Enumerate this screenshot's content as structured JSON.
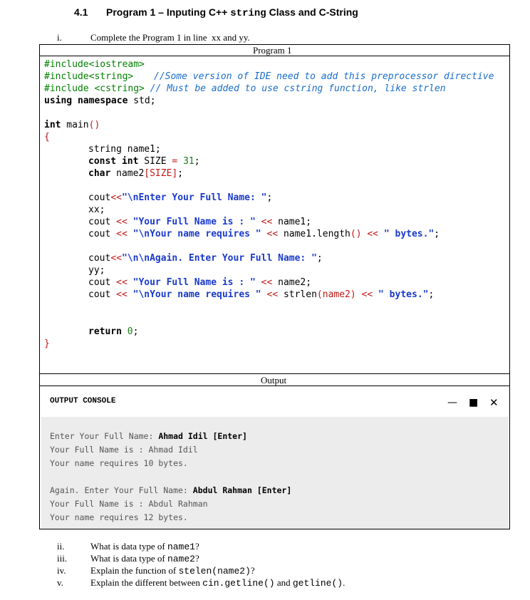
{
  "section": {
    "number": "4.1",
    "title_prefix": "Program 1 – Inputing C++ ",
    "title_mono": "string",
    "title_suffix": " Class and C-String"
  },
  "questions": [
    {
      "numeral": "i.",
      "text": "Complete the Program 1 in line  xx and yy."
    },
    {
      "numeral": "ii.",
      "text_before": "What is data type of ",
      "code": "name1",
      "text_after": "?"
    },
    {
      "numeral": "iii.",
      "text_before": "What is data type of ",
      "code": "name2",
      "text_after": "?"
    },
    {
      "numeral": "iv.",
      "text_before": "Explain the function of ",
      "code": "stelen(name2)",
      "text_after": "?"
    },
    {
      "numeral": "v.",
      "text_before": "Explain the different between ",
      "code": "cin.getline()",
      "text_mid": " and ",
      "code2": "getline()",
      "text_after": "."
    }
  ],
  "program_box": {
    "caption": "Program 1",
    "code": {
      "inc1": "#include<iostream>",
      "inc2": "#include<string>",
      "inc2_comment": "//Some version of IDE need to add this preprocessor directive",
      "inc3": "#include <cstring>",
      "inc3_comment": "// Must be added to use cstring function, like strlen",
      "using_kw": "using namespace",
      "using_rest": " std;",
      "main_kw": "int",
      "main_rest": " main",
      "main_paren": "()",
      "open_brace": "{",
      "close_brace": "}",
      "l_name1": "string name1;",
      "l_size_kw": "const int",
      "l_size_rest": " SIZE ",
      "l_size_eq": "=",
      "l_size_num": " 31",
      "l_size_end": ";",
      "l_name2_kw": "char",
      "l_name2_rest": " name2",
      "l_name2_br": "[SIZE]",
      "l_name2_end": ";",
      "cout1_a": "cout",
      "cout1_op": "<<",
      "cout1_str": "\"\\nEnter Your Full Name: \"",
      "cout1_end": ";",
      "xx": "xx;",
      "cout2_a": "cout ",
      "cout2_op": "<<",
      "cout2_str": " \"Your Full Name is : \" ",
      "cout2_op2": "<<",
      "cout2_rest": " name1;",
      "cout3_a": "cout ",
      "cout3_op": "<<",
      "cout3_str": " \"\\nYour name requires \" ",
      "cout3_op2": "<<",
      "cout3_rest": " name1.length",
      "cout3_paren": "()",
      "cout3_op3": " <<",
      "cout3_str2": " \" bytes.\"",
      "cout3_end": ";",
      "cout4_a": "cout",
      "cout4_op": "<<",
      "cout4_str": "\"\\n\\nAgain. Enter Your Full Name: \"",
      "cout4_end": ";",
      "yy": "yy;",
      "cout5_a": "cout ",
      "cout5_op": "<<",
      "cout5_str": " \"Your Full Name is : \" ",
      "cout5_op2": "<<",
      "cout5_rest": " name2;",
      "cout6_a": "cout ",
      "cout6_op": "<<",
      "cout6_str": " \"\\nYour name requires \" ",
      "cout6_op2": "<<",
      "cout6_rest": " strlen",
      "cout6_paren": "(name2)",
      "cout6_op3": " <<",
      "cout6_str2": " \" bytes.\"",
      "cout6_end": ";",
      "ret_kw": "return",
      "ret_num": " 0",
      "ret_end": ";"
    }
  },
  "output_box": {
    "caption": "Output",
    "console_title": "OUTPUT CONSOLE",
    "controls": {
      "minimize": "—",
      "maximize": "■",
      "close": "✕"
    },
    "lines": [
      {
        "plain": "Enter Your Full Name: ",
        "user": "Ahmad Idil [Enter]"
      },
      {
        "plain": "Your Full Name is : Ahmad Idil",
        "user": ""
      },
      {
        "plain": "Your name requires 10 bytes.",
        "user": ""
      },
      {
        "plain": "Again. Enter Your Full Name: ",
        "user": "Abdul Rahman [Enter]"
      },
      {
        "plain": "Your Full Name is : Abdul Rahman",
        "user": ""
      },
      {
        "plain": "Your name requires 12 bytes.",
        "user": ""
      }
    ]
  }
}
